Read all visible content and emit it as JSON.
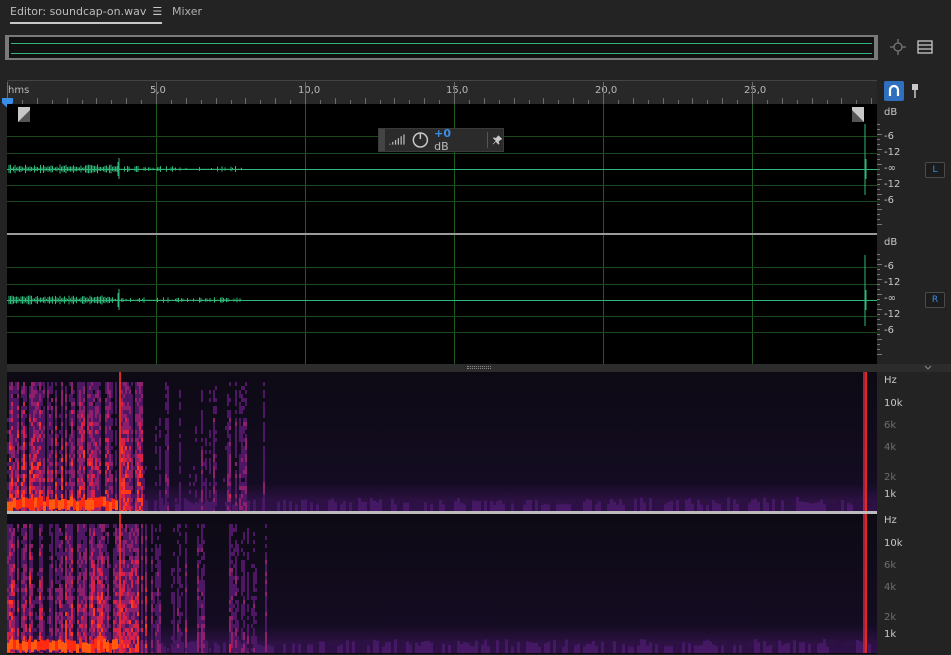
{
  "tabs": {
    "editor_label": "Editor: soundcap-on.wav",
    "editor_menu_glyph": "☰",
    "mixer_label": "Mixer"
  },
  "overview": {
    "zoom_icon": "zoom-navigator-icon",
    "list_icon": "list-menu-icon"
  },
  "ruler": {
    "unit": "hms",
    "labels": [
      "5,0",
      "10,0",
      "15,0",
      "20,0",
      "25,0"
    ],
    "snap_icon": "magnet-icon",
    "pin_icon": "pin-icon"
  },
  "hud": {
    "volume_value": "+0",
    "volume_unit": "dB",
    "pin_icon": "pin-icon",
    "knob_icon": "volume-knob-icon"
  },
  "channels": {
    "left": {
      "tag": "L",
      "db_unit": "dB",
      "db_labels": [
        "-6",
        "-12",
        "-∞",
        "-12",
        "-6"
      ]
    },
    "right": {
      "tag": "R",
      "db_unit": "dB",
      "db_labels": [
        "-6",
        "-12",
        "-∞",
        "-12",
        "-6"
      ]
    }
  },
  "spectral": {
    "left": {
      "unit": "Hz",
      "labels": [
        "10k",
        "6k",
        "4k",
        "2k",
        "1k"
      ]
    },
    "right": {
      "unit": "Hz",
      "labels": [
        "10k",
        "6k",
        "4k",
        "2k",
        "1k"
      ]
    }
  },
  "colors": {
    "waveform": "#2fb87a",
    "accent": "#3a8ee6",
    "grid": "#1f5a1f"
  }
}
